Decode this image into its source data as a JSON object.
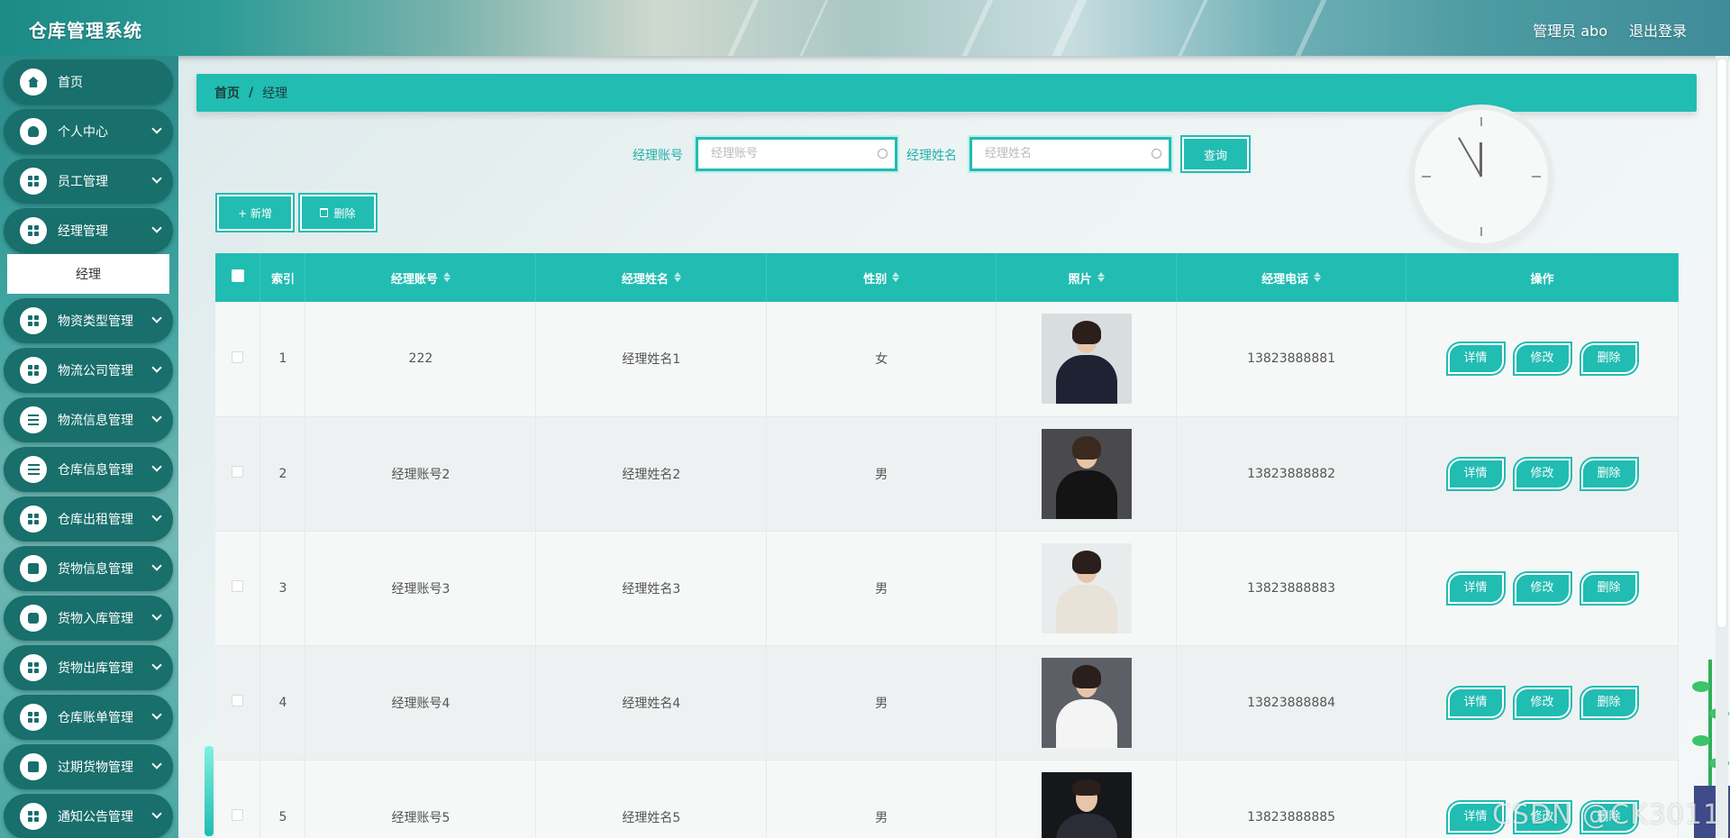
{
  "app": {
    "title": "仓库管理系统",
    "user_label": "管理员 abo",
    "logout_label": "退出登录"
  },
  "sidebar": {
    "items": [
      {
        "label": "首页",
        "icon": "home-icon"
      },
      {
        "label": "个人中心",
        "icon": "user-icon"
      },
      {
        "label": "员工管理",
        "icon": "grid-icon"
      },
      {
        "label": "经理管理",
        "icon": "grid-icon"
      },
      {
        "label": "物资类型管理",
        "icon": "grid-icon"
      },
      {
        "label": "物流公司管理",
        "icon": "grid-icon"
      },
      {
        "label": "物流信息管理",
        "icon": "list-icon"
      },
      {
        "label": "仓库信息管理",
        "icon": "sliders-icon"
      },
      {
        "label": "仓库出租管理",
        "icon": "grid-icon"
      },
      {
        "label": "货物信息管理",
        "icon": "clipboard-icon"
      },
      {
        "label": "货物入库管理",
        "icon": "chat-icon"
      },
      {
        "label": "货物出库管理",
        "icon": "grid-icon"
      },
      {
        "label": "仓库账单管理",
        "icon": "grid-icon"
      },
      {
        "label": "过期货物管理",
        "icon": "chart-icon"
      },
      {
        "label": "通知公告管理",
        "icon": "apps-icon"
      }
    ],
    "submenu": {
      "label": "经理"
    }
  },
  "breadcrumb": {
    "home": "首页",
    "separator": "/",
    "current": "经理"
  },
  "search": {
    "account_label": "经理账号",
    "account_placeholder": "经理账号",
    "name_label": "经理姓名",
    "name_placeholder": "经理姓名",
    "query_label": "查询"
  },
  "actions": {
    "add_label": "+ 新增",
    "delete_label": "删除"
  },
  "table": {
    "headers": {
      "index": "索引",
      "account": "经理账号",
      "name": "经理姓名",
      "gender": "性别",
      "photo": "照片",
      "phone": "经理电话",
      "ops": "操作"
    },
    "row_actions": {
      "detail": "详情",
      "edit": "修改",
      "delete": "删除"
    },
    "rows": [
      {
        "index": "1",
        "account": "222",
        "name": "经理姓名1",
        "gender": "女",
        "phone": "13823888881"
      },
      {
        "index": "2",
        "account": "经理账号2",
        "name": "经理姓名2",
        "gender": "男",
        "phone": "13823888882"
      },
      {
        "index": "3",
        "account": "经理账号3",
        "name": "经理姓名3",
        "gender": "男",
        "phone": "13823888883"
      },
      {
        "index": "4",
        "account": "经理账号4",
        "name": "经理姓名4",
        "gender": "男",
        "phone": "13823888884"
      },
      {
        "index": "5",
        "account": "经理账号5",
        "name": "经理姓名5",
        "gender": "男",
        "phone": "13823888885"
      }
    ]
  },
  "watermark": "CSDN @CK3011",
  "colors": {
    "accent": "#21bcb2",
    "sidebar_item": "#186f6c"
  }
}
